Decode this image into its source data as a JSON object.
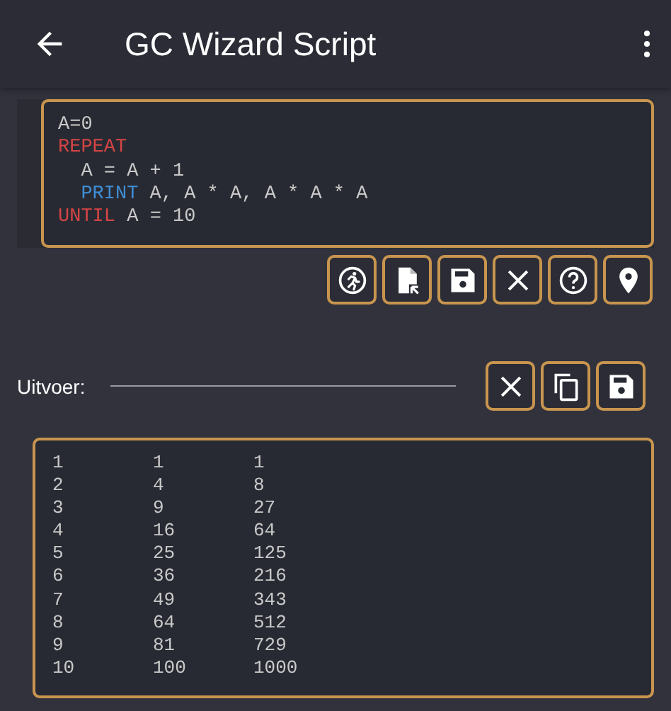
{
  "app_bar": {
    "title": "GC Wizard Script"
  },
  "script": {
    "lines": [
      {
        "indented": false,
        "tokens": [
          {
            "kind": "plain",
            "text": "A=0"
          }
        ]
      },
      {
        "indented": false,
        "tokens": [
          {
            "kind": "keyword",
            "text": "REPEAT"
          }
        ]
      },
      {
        "indented": true,
        "tokens": [
          {
            "kind": "plain",
            "text": "A = A + 1"
          }
        ]
      },
      {
        "indented": true,
        "tokens": [
          {
            "kind": "builtin",
            "text": "PRINT"
          },
          {
            "kind": "plain",
            "text": " A, A * A, A * A * A"
          }
        ]
      },
      {
        "indented": false,
        "tokens": [
          {
            "kind": "keyword",
            "text": "UNTIL"
          },
          {
            "kind": "plain",
            "text": " A = 10"
          }
        ]
      }
    ]
  },
  "output": {
    "label": "Uitvoer:",
    "rows": [
      [
        "1",
        "1",
        "1"
      ],
      [
        "2",
        "4",
        "8"
      ],
      [
        "3",
        "9",
        "27"
      ],
      [
        "4",
        "16",
        "64"
      ],
      [
        "5",
        "25",
        "125"
      ],
      [
        "6",
        "36",
        "216"
      ],
      [
        "7",
        "49",
        "343"
      ],
      [
        "8",
        "64",
        "512"
      ],
      [
        "9",
        "81",
        "729"
      ],
      [
        "10",
        "100",
        "1000"
      ]
    ]
  }
}
